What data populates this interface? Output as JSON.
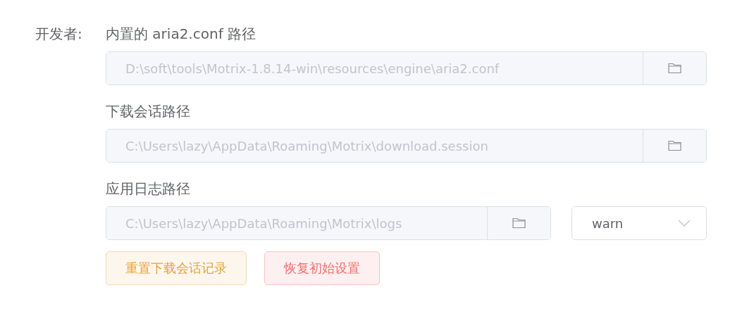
{
  "label": "开发者:",
  "paths": [
    {
      "title": "内置的 aria2.conf 路径",
      "value": "D:\\soft\\tools\\Motrix-1.8.14-win\\resources\\engine\\aria2.conf",
      "disabled": true
    },
    {
      "title": "下载会话路径",
      "value": "C:\\Users\\lazy\\AppData\\Roaming\\Motrix\\download.session",
      "disabled": true
    },
    {
      "title": "应用日志路径",
      "value": "C:\\Users\\lazy\\AppData\\Roaming\\Motrix\\logs",
      "disabled": true,
      "select": {
        "value": "warn"
      }
    }
  ],
  "buttons": [
    {
      "label": "重置下载会话记录",
      "kind": "warning"
    },
    {
      "label": "恢复初始设置",
      "kind": "danger"
    }
  ]
}
